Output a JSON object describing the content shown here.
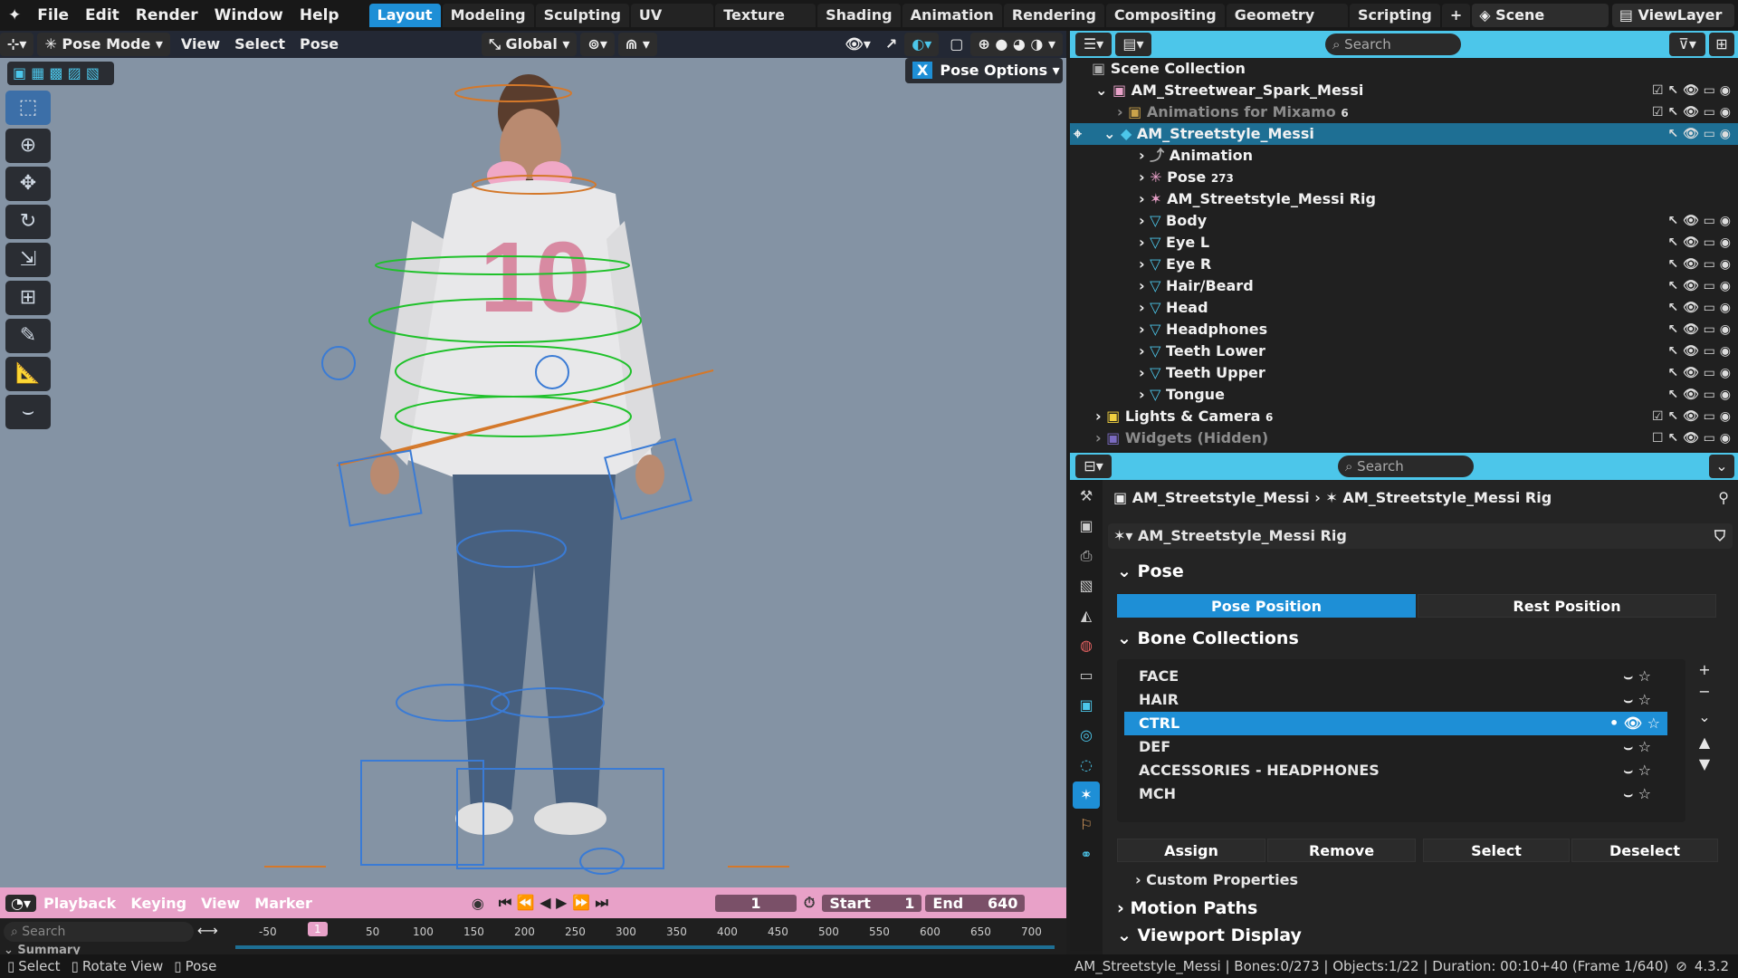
{
  "menus": [
    "File",
    "Edit",
    "Render",
    "Window",
    "Help"
  ],
  "workspace_tabs": [
    "Layout",
    "Modeling",
    "Sculpting",
    "UV Editing",
    "Texture Paint",
    "Shading",
    "Animation",
    "Rendering",
    "Compositing",
    "Geometry Nodes",
    "Scripting"
  ],
  "scene_label": "Scene",
  "viewlayer_label": "ViewLayer",
  "viewport": {
    "mode": "Pose Mode",
    "menu": [
      "View",
      "Select",
      "Pose"
    ],
    "transform_orientation": "Global",
    "pose_options": "Pose Options",
    "x_label": "X"
  },
  "outliner": {
    "search_placeholder": "Search",
    "rows": [
      {
        "name": "Scene Collection",
        "badge": ""
      },
      {
        "name": "AM_Streetwear_Spark_Messi",
        "badge": ""
      },
      {
        "name": "Animations for Mixamo",
        "badge": "6"
      },
      {
        "name": "AM_Streetstyle_Messi",
        "badge": ""
      },
      {
        "name": "Animation",
        "badge": ""
      },
      {
        "name": "Pose",
        "badge": "273"
      },
      {
        "name": "AM_Streetstyle_Messi Rig",
        "badge": ""
      },
      {
        "name": "Body",
        "badge": ""
      },
      {
        "name": "Eye L",
        "badge": ""
      },
      {
        "name": "Eye R",
        "badge": ""
      },
      {
        "name": "Hair/Beard",
        "badge": ""
      },
      {
        "name": "Head",
        "badge": ""
      },
      {
        "name": "Headphones",
        "badge": ""
      },
      {
        "name": "Teeth Lower",
        "badge": ""
      },
      {
        "name": "Teeth Upper",
        "badge": ""
      },
      {
        "name": "Tongue",
        "badge": ""
      },
      {
        "name": "Lights & Camera",
        "badge": "6"
      },
      {
        "name": "Widgets (Hidden)",
        "badge": ""
      }
    ]
  },
  "properties": {
    "search_placeholder": "Search",
    "breadcrumb_object": "AM_Streetstyle_Messi",
    "breadcrumb_data": "AM_Streetstyle_Messi Rig",
    "data_name": "AM_Streetstyle_Messi Rig",
    "pose_section": "Pose",
    "pose_position": "Pose Position",
    "rest_position": "Rest Position",
    "bone_collections_section": "Bone Collections",
    "bone_collections": [
      "FACE",
      "HAIR",
      "CTRL",
      "DEF",
      "ACCESSORIES - HEADPHONES",
      "MCH"
    ],
    "assign": "Assign",
    "remove": "Remove",
    "select": "Select",
    "deselect": "Deselect",
    "custom_properties": "Custom Properties",
    "motion_paths": "Motion Paths",
    "viewport_display": "Viewport Display"
  },
  "timeline": {
    "menus": [
      "Playback",
      "Keying",
      "View",
      "Marker"
    ],
    "current_frame": "1",
    "start_label": "Start",
    "start_value": "1",
    "end_label": "End",
    "end_value": "640",
    "search_placeholder": "Search",
    "summary": "Summary",
    "ruler": [
      "-50",
      "1",
      "50",
      "100",
      "150",
      "200",
      "250",
      "300",
      "350",
      "400",
      "450",
      "500",
      "550",
      "600",
      "650",
      "700"
    ]
  },
  "status": {
    "select": "Select",
    "rotate_view": "Rotate View",
    "pose": "Pose",
    "info": "AM_Streetstyle_Messi | Bones:0/273 | Objects:1/22 | Duration: 00:10+40 (Frame 1/640)",
    "version": "4.3.2"
  },
  "colors": {
    "accent": "#1e8fd6",
    "header_cyan": "#4cc6ea",
    "timeline_pink": "#e8a1c8",
    "viewport_bg": "#8493a4"
  }
}
